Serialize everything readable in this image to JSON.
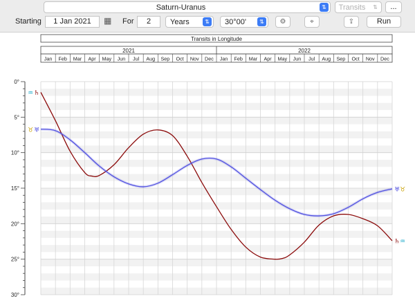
{
  "toolbar": {
    "chart_select": "Saturn-Uranus",
    "mode_select": "Transits",
    "more_label": "...",
    "starting_label": "Starting",
    "start_date": "1 Jan 2021",
    "for_label": "For",
    "duration_value": "2",
    "duration_unit": "Years",
    "orb_value": "30°00'",
    "run_label": "Run",
    "icons": [
      "calendar-icon",
      "gear-icon",
      "location-pin-icon",
      "share-icon"
    ]
  },
  "colors": {
    "saturn": "#8b0a0a",
    "uranus": "#5050e0",
    "accent": "#3c7cf6",
    "glyph_cyan": "#1aa9c9",
    "glyph_gold": "#c8a000"
  },
  "chart_data": {
    "type": "line",
    "title": "Transits in Longitude",
    "years": [
      "2021",
      "2022"
    ],
    "months": [
      "Jan",
      "Feb",
      "Mar",
      "Apr",
      "May",
      "Jun",
      "Jul",
      "Aug",
      "Sep",
      "Oct",
      "Nov",
      "Dec",
      "Jan",
      "Feb",
      "Mar",
      "Apr",
      "May",
      "Jun",
      "Jul",
      "Aug",
      "Sep",
      "Oct",
      "Nov",
      "Dec"
    ],
    "ylim": [
      0,
      30
    ],
    "yticks": [
      0,
      5,
      10,
      15,
      20,
      25,
      30
    ],
    "ytick_labels": [
      "0°",
      "5°",
      "10°",
      "15°",
      "20°",
      "25°",
      "30°"
    ],
    "grid": true,
    "series": [
      {
        "glyph": "♄",
        "sign_glyph": "♒",
        "color": "#8b0a0a",
        "x_months": [
          0,
          1,
          2,
          3,
          3.5,
          4,
          5,
          6,
          7,
          8,
          9,
          10,
          11,
          12,
          13,
          14,
          15,
          16,
          16.5,
          17,
          18,
          19,
          20,
          21,
          22,
          23,
          24
        ],
        "values": [
          1.5,
          5.5,
          9.8,
          12.8,
          13.3,
          13.2,
          11.7,
          9.3,
          7.4,
          6.8,
          7.6,
          10.5,
          14.2,
          17.6,
          20.8,
          23.3,
          24.7,
          25.0,
          24.9,
          24.4,
          22.6,
          20.2,
          18.9,
          18.7,
          19.3,
          20.3,
          22.4
        ]
      },
      {
        "glyph": "♅",
        "sign_glyph": "♉",
        "color": "#5050e0",
        "x_months": [
          0,
          1,
          2,
          3,
          4,
          5,
          6,
          7,
          8,
          9,
          10,
          11,
          12,
          13,
          14,
          15,
          16,
          17,
          18,
          19,
          20,
          21,
          22,
          23,
          24
        ],
        "values": [
          6.7,
          6.9,
          8.2,
          10.0,
          11.9,
          13.4,
          14.4,
          14.8,
          14.3,
          13.1,
          11.8,
          10.9,
          10.9,
          12.0,
          13.6,
          15.2,
          16.7,
          17.9,
          18.7,
          18.9,
          18.6,
          17.7,
          16.5,
          15.6,
          15.1
        ]
      }
    ]
  }
}
